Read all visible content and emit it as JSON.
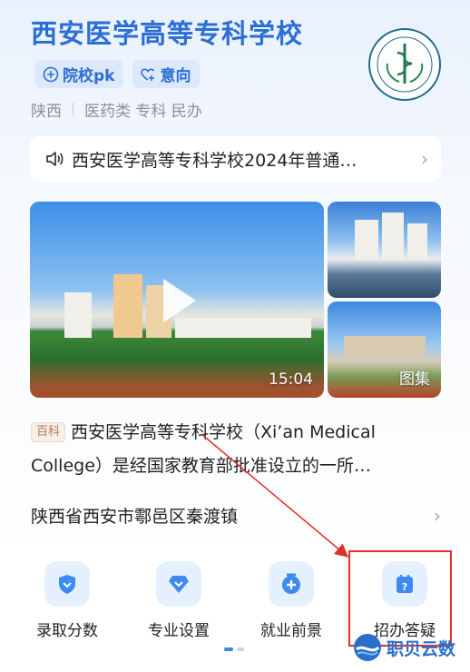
{
  "header": {
    "title": "西安医学高等专科学校",
    "tags": [
      {
        "icon": "plus-circle-icon",
        "label": "院校pk"
      },
      {
        "icon": "heart-plus-icon",
        "label": "意向"
      }
    ],
    "meta": {
      "region": "陕西",
      "attributes": "医药类 专科 民办"
    },
    "logo_text": "XI'AN MEDICAL COLLEGE"
  },
  "notice": {
    "icon": "speaker-icon",
    "text": "西安医学高等专科学校2024年普通…"
  },
  "media": {
    "duration": "15:04",
    "gallery_label": "图集"
  },
  "description": {
    "badge": "百科",
    "text": "西安医学高等专科学校（Xi’an Medical College）是经国家教育部批准设立的一所…"
  },
  "address": {
    "text": "陕西省西安市鄠邑区秦渡镇"
  },
  "quick_links": [
    {
      "label": "录取分数",
      "icon": "shield-icon"
    },
    {
      "label": "专业设置",
      "icon": "diamond-icon"
    },
    {
      "label": "就业前景",
      "icon": "plus-badge-icon"
    },
    {
      "label": "招办答疑",
      "icon": "question-calendar-icon"
    }
  ],
  "watermark": {
    "text": "职贝云数"
  },
  "colors": {
    "accent": "#2b6ed6",
    "highlight": "#e0312a"
  }
}
